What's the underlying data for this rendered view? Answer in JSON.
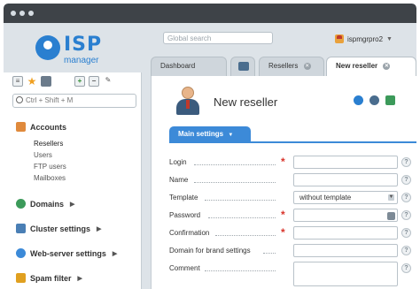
{
  "window": {
    "titlebar_dots": [
      "#d6dde3",
      "#d6dde3",
      "#d6dde3"
    ]
  },
  "header": {
    "logo_text": "ISP",
    "logo_subtext": "manager",
    "search_placeholder": "Global search",
    "user_name": "ispmgrpro2"
  },
  "tabs": [
    {
      "label": "Dashboard",
      "closable": false,
      "active": false
    },
    {
      "label": "",
      "icon": "panel-icon",
      "closable": false,
      "active": false
    },
    {
      "label": "Resellers",
      "closable": true,
      "active": false
    },
    {
      "label": "New reseller",
      "closable": true,
      "active": true
    }
  ],
  "sidebar": {
    "search_placeholder": "Ctrl + Shift + M",
    "groups": [
      {
        "label": "Accounts",
        "icon": "users-icon",
        "color": "#e08a3c",
        "items": [
          "Resellers",
          "Users",
          "FTP users",
          "Mailboxes"
        ],
        "active_item": "Resellers"
      },
      {
        "label": "Domains",
        "icon": "globe-icon",
        "color": "#3c9a5a"
      },
      {
        "label": "Cluster settings",
        "icon": "cluster-icon",
        "color": "#4a7fb5"
      },
      {
        "label": "Web-server settings",
        "icon": "web-icon",
        "color": "#3c8ad8"
      },
      {
        "label": "Spam filter",
        "icon": "spam-icon",
        "color": "#e0a020"
      }
    ]
  },
  "main": {
    "title": "New reseller",
    "section_tab": "Main settings",
    "form": {
      "rows": [
        {
          "label": "Login",
          "required": true,
          "value": "",
          "type": "text"
        },
        {
          "label": "Name",
          "required": false,
          "value": "",
          "type": "text"
        },
        {
          "label": "Template",
          "required": false,
          "value": "without template",
          "type": "select"
        },
        {
          "label": "Password",
          "required": true,
          "value": "",
          "type": "password"
        },
        {
          "label": "Confirmation",
          "required": true,
          "value": "",
          "type": "text"
        },
        {
          "label": "Domain for brand settings",
          "required": false,
          "value": "",
          "type": "text"
        },
        {
          "label": "Comment",
          "required": false,
          "value": "",
          "type": "textarea"
        }
      ],
      "help_glyph": "?",
      "required_glyph": "*"
    }
  },
  "colors": {
    "accent": "#3c8ad8",
    "required": "#d9342b",
    "titlebar": "#3e4348"
  }
}
